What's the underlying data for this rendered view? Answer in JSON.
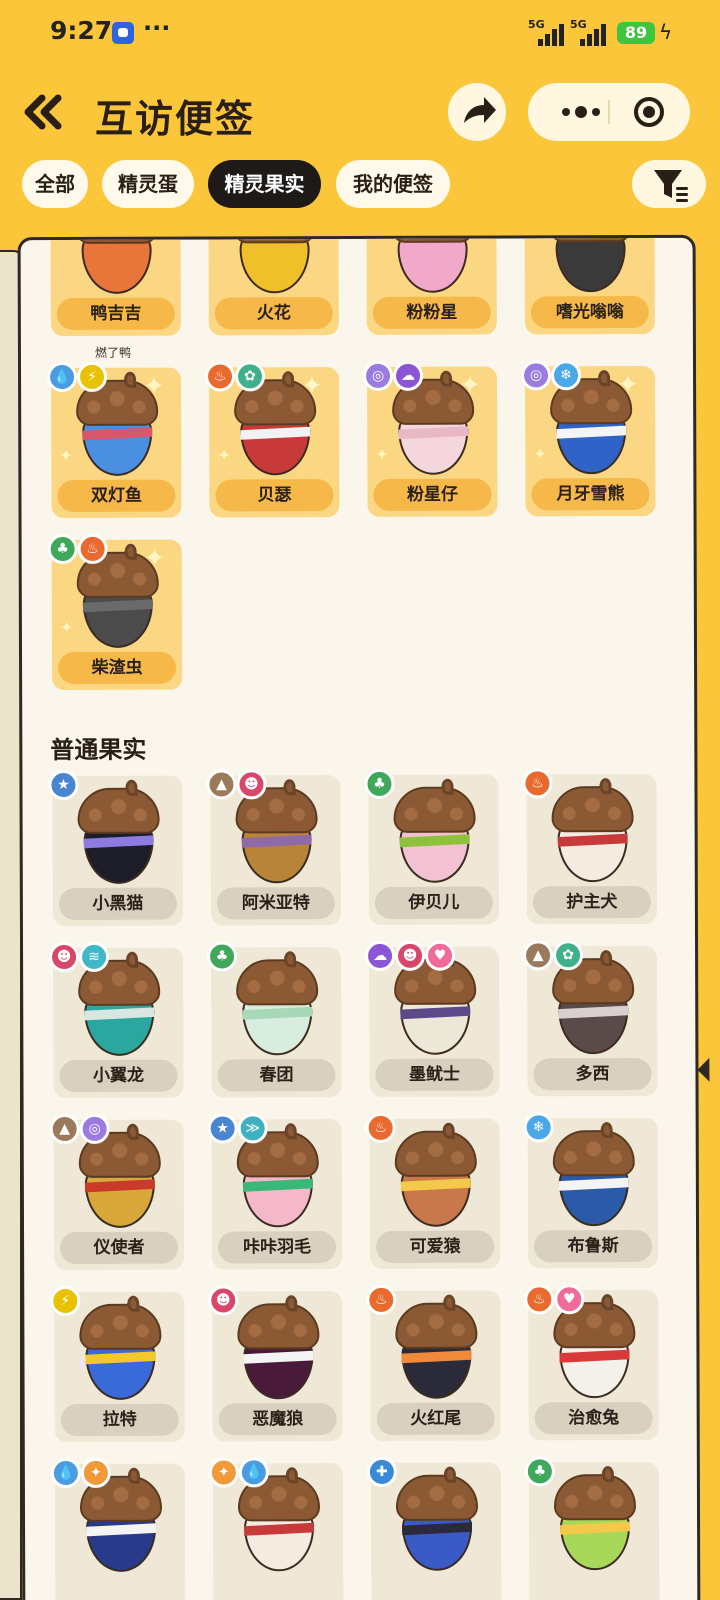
{
  "status": {
    "time": "9:27",
    "dots": "···",
    "sig1": "5G",
    "sig2": "5G",
    "battery": "89"
  },
  "header": {
    "title": "互访便签"
  },
  "tabs": [
    {
      "label": "全部",
      "active": false
    },
    {
      "label": "精灵蛋",
      "active": false
    },
    {
      "label": "精灵果实",
      "active": true
    },
    {
      "label": "我的便签",
      "active": false
    }
  ],
  "top_row": [
    "鸭吉吉",
    "火花",
    "粉粉星",
    "嗜光嗡嗡"
  ],
  "note": "燃了鸭",
  "rare": [
    {
      "name": "双灯鱼",
      "badges": [
        "water",
        "electric"
      ],
      "color": "#4a8fe0",
      "stripe": "#d9576a"
    },
    {
      "name": "贝瑟",
      "badges": [
        "fire",
        "flower"
      ],
      "color": "#c83a3a",
      "stripe": "#f2f2f2"
    },
    {
      "name": "粉星仔",
      "badges": [
        "illusion",
        "ghost"
      ],
      "color": "#f4d6dc",
      "stripe": "#e8b8c6"
    },
    {
      "name": "月牙雪熊",
      "badges": [
        "illusion",
        "ice"
      ],
      "color": "#2f63c8",
      "stripe": "#f4f4f4"
    },
    {
      "name": "柴渣虫",
      "badges": [
        "grass",
        "fire"
      ],
      "color": "#4b4b4b",
      "stripe": "#6a6a6a"
    }
  ],
  "section_title": "普通果实",
  "normal": [
    {
      "name": "小黑猫",
      "badges": [
        "normal"
      ],
      "color": "#1d1d2a",
      "stripe": "#8e7be0"
    },
    {
      "name": "阿米亚特",
      "badges": [
        "earth",
        "evil"
      ],
      "color": "#b8843a",
      "stripe": "#8e6aa8"
    },
    {
      "name": "伊贝儿",
      "badges": [
        "grass"
      ],
      "color": "#f2c2d2",
      "stripe": "#8ec23a"
    },
    {
      "name": "护主犬",
      "badges": [
        "fire"
      ],
      "color": "#f4ece0",
      "stripe": "#c83a3a"
    },
    {
      "name": "小翼龙",
      "badges": [
        "evil",
        "wind"
      ],
      "color": "#2aa8a0",
      "stripe": "#d8e8e0"
    },
    {
      "name": "春团",
      "badges": [
        "grass"
      ],
      "color": "#d8ece0",
      "stripe": "#a8d8b8"
    },
    {
      "name": "墨鱿士",
      "badges": [
        "ghost",
        "evil",
        "cute"
      ],
      "color": "#ece8d8",
      "stripe": "#5a4a8a"
    },
    {
      "name": "多西",
      "badges": [
        "earth",
        "flower"
      ],
      "color": "#5a4a4a",
      "stripe": "#d8d0d0"
    },
    {
      "name": "仪使者",
      "badges": [
        "earth",
        "illusion"
      ],
      "color": "#d8a83a",
      "stripe": "#c83a2a"
    },
    {
      "name": "咔咔羽毛",
      "badges": [
        "normal",
        "wing"
      ],
      "color": "#f4b8c8",
      "stripe": "#3ab87a"
    },
    {
      "name": "可爱猿",
      "badges": [
        "fire"
      ],
      "color": "#c8784a",
      "stripe": "#f4c84a"
    },
    {
      "name": "布鲁斯",
      "badges": [
        "ice"
      ],
      "color": "#2a5aa8",
      "stripe": "#f4f4f4"
    },
    {
      "name": "拉特",
      "badges": [
        "electric"
      ],
      "color": "#3a6ad8",
      "stripe": "#f4c82a"
    },
    {
      "name": "恶魔狼",
      "badges": [
        "evil"
      ],
      "color": "#4a1a3a",
      "stripe": "#f4f4f4"
    },
    {
      "name": "火红尾",
      "badges": [
        "fire"
      ],
      "color": "#2a2a3a",
      "stripe": "#f08a3a"
    },
    {
      "name": "治愈兔",
      "badges": [
        "fire",
        "cute"
      ],
      "color": "#f4f0ea",
      "stripe": "#d83a3a"
    },
    {
      "name": "",
      "badges": [
        "water",
        "light"
      ],
      "color": "#2a3a8a",
      "stripe": "#f4f4f4"
    },
    {
      "name": "",
      "badges": [
        "light",
        "water"
      ],
      "color": "#f4ece0",
      "stripe": "#c83a3a"
    },
    {
      "name": "",
      "badges": [
        "mech"
      ],
      "color": "#3a5ac8",
      "stripe": "#2a2a3a"
    },
    {
      "name": "",
      "badges": [
        "grass"
      ],
      "color": "#a8d85a",
      "stripe": "#f4c84a"
    }
  ]
}
